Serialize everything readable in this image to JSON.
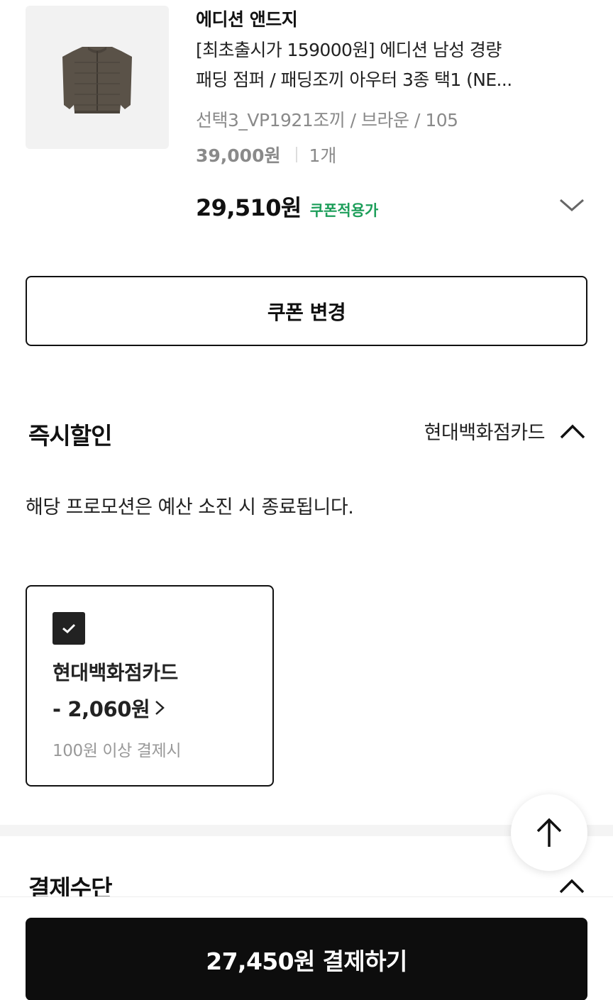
{
  "product": {
    "brand": "에디션 앤드지",
    "name_line1": "[최초출시가 159000원] 에디션 남성 경량",
    "name_line2": "패딩 점퍼 / 패딩조끼 아우터 3종 택1 (NE...",
    "option": "선택3_VP1921조끼 / 브라운 / 105",
    "original_price": "39,000원",
    "quantity": "1개",
    "final_price": "29,510원",
    "coupon_applied": "쿠폰적용가",
    "image_icon": "padded-jacket-image"
  },
  "coupon_button": {
    "label": "쿠폰 변경"
  },
  "instant_discount": {
    "title": "즉시할인",
    "selected_card": "현대백화점카드",
    "notice": "해당 프로모션은 예산 소진 시 종료됩니다.",
    "card": {
      "name": "현대백화점카드",
      "discount": "- 2,060원",
      "condition": "100원 이상 결제시",
      "checked": true
    }
  },
  "payment_method": {
    "title": "결제수단"
  },
  "checkout": {
    "label": "27,450원 결제하기"
  },
  "colors": {
    "coupon_green": "#1d9e5a",
    "button_black": "#0d0d0d",
    "muted_gray": "#8a8a8a"
  }
}
